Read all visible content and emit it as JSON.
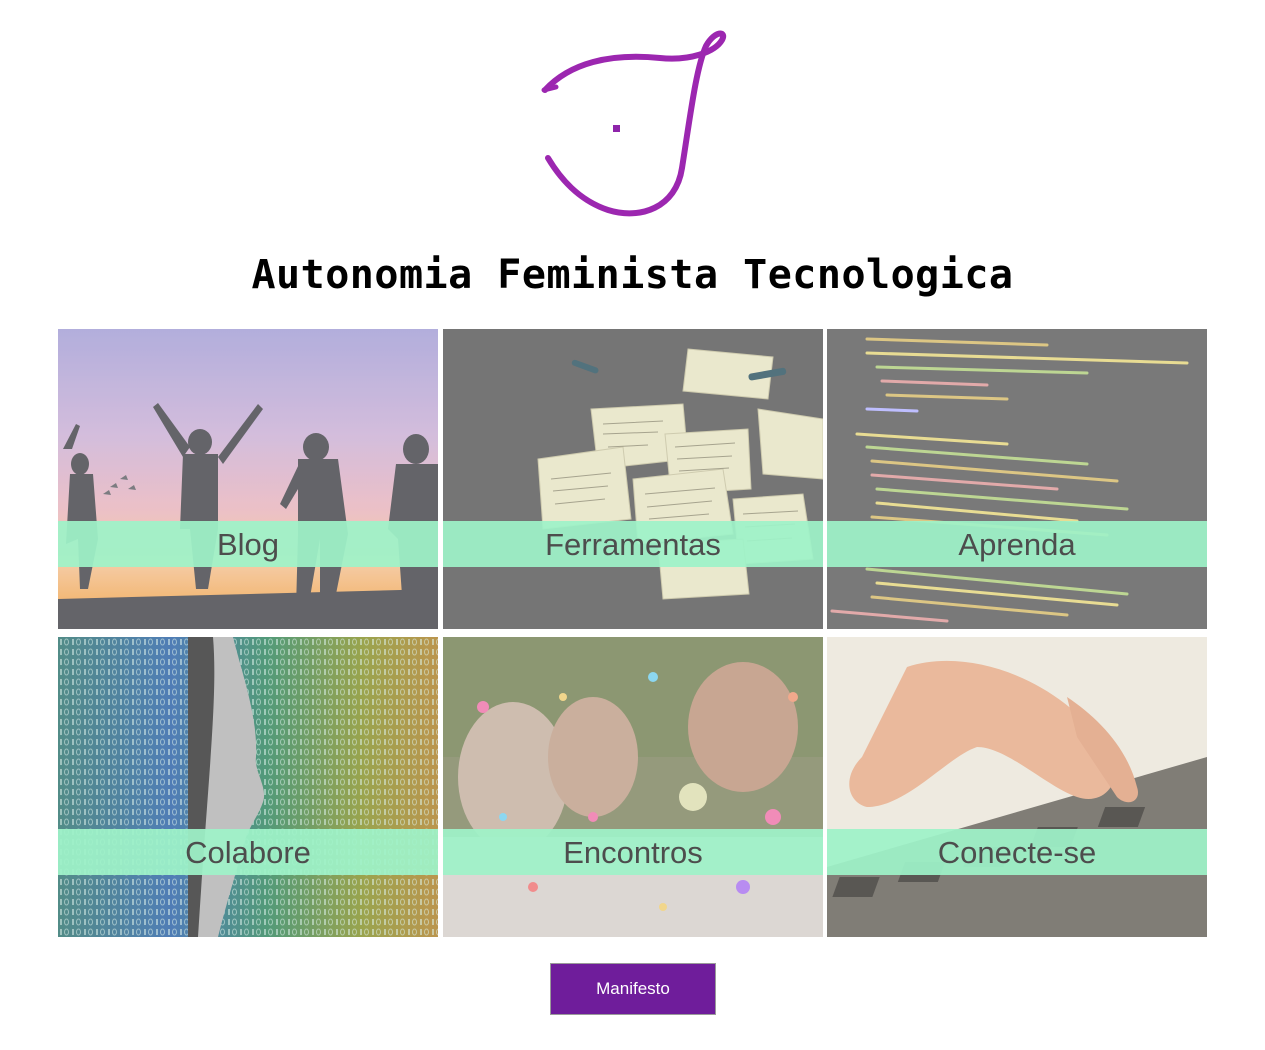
{
  "site": {
    "title": "Autonomia Feminista Tecnologica",
    "logo_icon": "af-script-logo-icon",
    "accent_color": "#8e24aa"
  },
  "tiles": [
    {
      "label": "Blog",
      "image": "silhouettes-sunset-image"
    },
    {
      "label": "Ferramentas",
      "image": "sticky-notes-image"
    },
    {
      "label": "Aprenda",
      "image": "source-code-image"
    },
    {
      "label": "Colabore",
      "image": "binary-profile-image"
    },
    {
      "label": "Encontros",
      "image": "confetti-women-image"
    },
    {
      "label": "Conecte-se",
      "image": "hands-keyboard-image"
    }
  ],
  "band_color": "#9ef2c8",
  "manifesto": {
    "label": "Manifesto",
    "color": "#6f1d9b"
  }
}
